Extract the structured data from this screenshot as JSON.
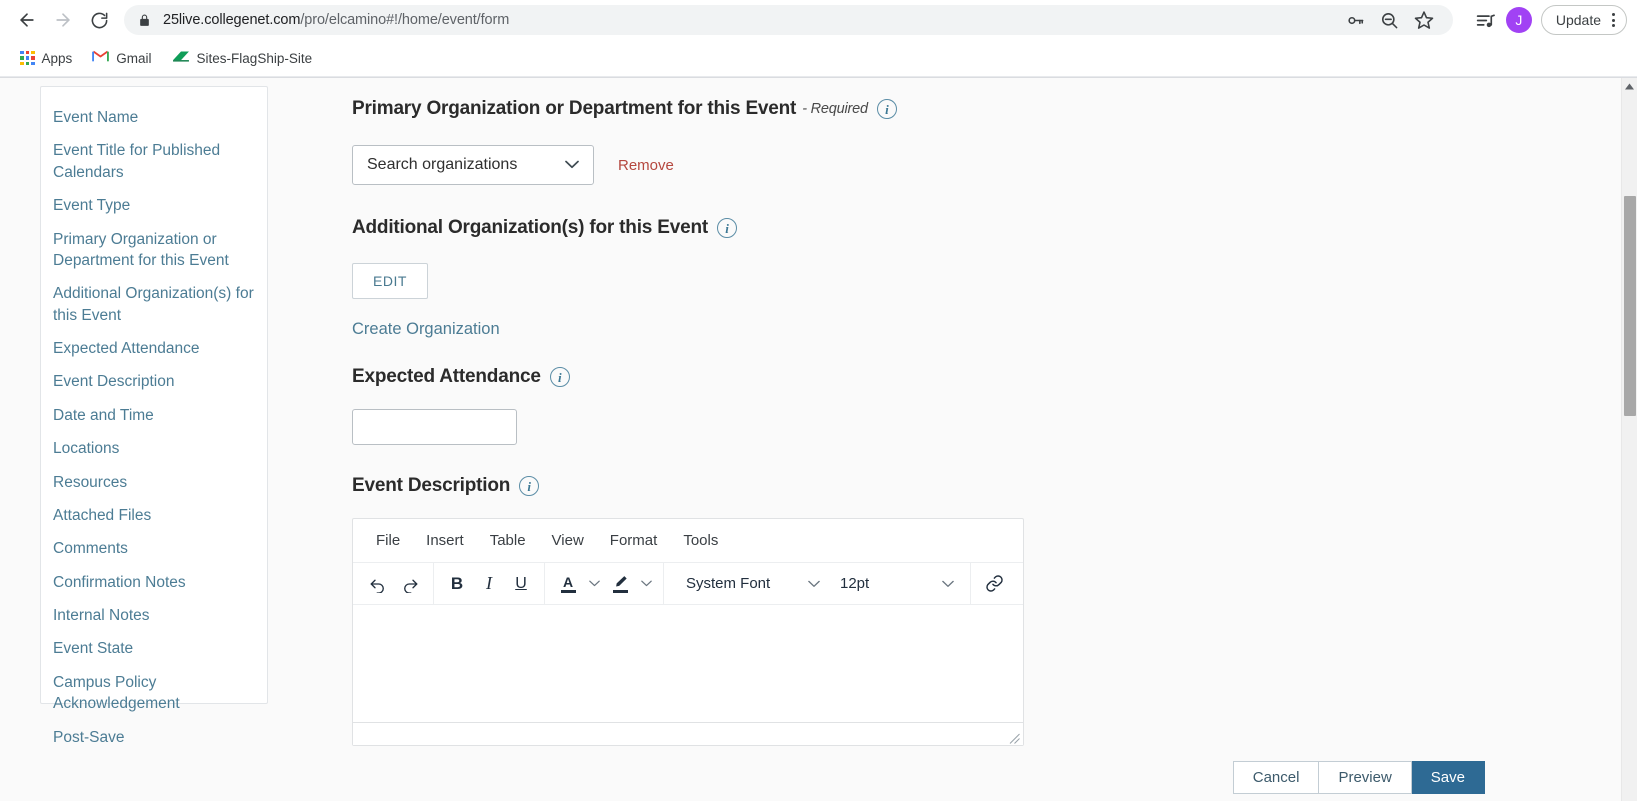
{
  "browser": {
    "nav": {
      "back_icon": "arrow-left-icon",
      "forward_icon": "arrow-right-icon",
      "reload_icon": "reload-icon"
    },
    "omnibox": {
      "lock_icon": "lock-icon",
      "url_host": "25live.collegenet.com",
      "url_path": "/pro/elcamino#!/home/event/form",
      "full_url": "25live.collegenet.com/pro/elcamino#!/home/event/form",
      "actions": [
        {
          "icon": "password-key-icon",
          "title": "Save password"
        },
        {
          "icon": "zoom-out-icon",
          "title": "Zoom out"
        },
        {
          "icon": "bookmark-star-icon",
          "title": "Bookmark this tab"
        }
      ]
    },
    "right_actions": {
      "media_icon": "media-playlist-icon",
      "avatar_initial": "J",
      "update_label": "Update",
      "menu_icon": "kebab-menu-icon"
    },
    "bookmarks": [
      {
        "label": "Apps",
        "icon": "apps-grid-icon"
      },
      {
        "label": "Gmail",
        "icon": "gmail-icon"
      },
      {
        "label": "Sites-FlagShip-Site",
        "icon": "google-sites-icon"
      }
    ]
  },
  "sidebar": {
    "items": [
      {
        "label": "Event Name"
      },
      {
        "label": "Event Title for Published Calendars"
      },
      {
        "label": "Event Type"
      },
      {
        "label": "Primary Organization or Department for this Event"
      },
      {
        "label": "Additional Organization(s) for this Event"
      },
      {
        "label": "Expected Attendance"
      },
      {
        "label": "Event Description"
      },
      {
        "label": "Date and Time"
      },
      {
        "label": "Locations"
      },
      {
        "label": "Resources"
      },
      {
        "label": "Attached Files"
      },
      {
        "label": "Comments"
      },
      {
        "label": "Confirmation Notes"
      },
      {
        "label": "Internal Notes"
      },
      {
        "label": "Event State"
      },
      {
        "label": "Campus Policy Acknowledgement"
      },
      {
        "label": "Post-Save"
      }
    ]
  },
  "form": {
    "primary_org": {
      "heading": "Primary Organization or Department for this Event",
      "required_tag": "- Required",
      "info_icon": "info-icon",
      "select_value": "Search organizations",
      "chevron_icon": "chevron-down-icon",
      "remove_label": "Remove"
    },
    "additional_org": {
      "heading": "Additional Organization(s) for this Event",
      "info_icon": "info-icon",
      "edit_label": "EDIT",
      "create_label": "Create Organization"
    },
    "expected_attendance": {
      "heading": "Expected Attendance",
      "info_icon": "info-icon",
      "value": "",
      "placeholder": ""
    },
    "event_description": {
      "heading": "Event Description",
      "info_icon": "info-icon",
      "editor": {
        "menus": [
          "File",
          "Insert",
          "Table",
          "View",
          "Format",
          "Tools"
        ],
        "toolbar": {
          "undo_icon": "undo-icon",
          "redo_icon": "redo-icon",
          "bold_label": "B",
          "italic_label": "I",
          "underline_label": "U",
          "text_color_label": "A",
          "text_color_icon": "text-color-icon",
          "highlight_icon": "highlight-pen-icon",
          "font_family_value": "System Font",
          "font_size_value": "12pt",
          "link_icon": "link-icon",
          "chevron_icon": "chevron-down-icon"
        },
        "content": ""
      }
    }
  },
  "footer": {
    "cancel_label": "Cancel",
    "preview_label": "Preview",
    "save_label": "Save"
  },
  "colors": {
    "accent_blue": "#4c7c94",
    "save_blue": "#2e6a94",
    "remove_red": "#b5483f",
    "avatar_purple": "#a142f4"
  }
}
